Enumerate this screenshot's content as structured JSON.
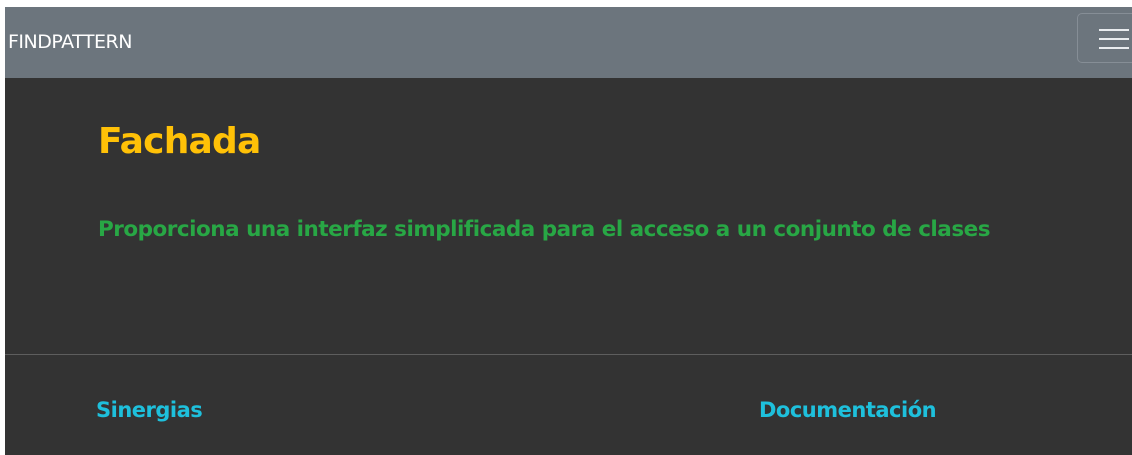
{
  "navbar": {
    "brand": "FINDPATTERN",
    "toggler_icon": "hamburger-menu-icon"
  },
  "pattern": {
    "title": "Fachada",
    "description": "Proporciona una interfaz simplificada para el acceso a un conjunto de clases"
  },
  "footer": {
    "links": [
      {
        "label": "Sinergias"
      },
      {
        "label": "Documentación"
      }
    ]
  },
  "colors": {
    "navbar_bg": "#6c757d",
    "page_bg": "#333333",
    "title": "#ffc107",
    "description": "#28a745",
    "link": "#1ec0dc"
  }
}
